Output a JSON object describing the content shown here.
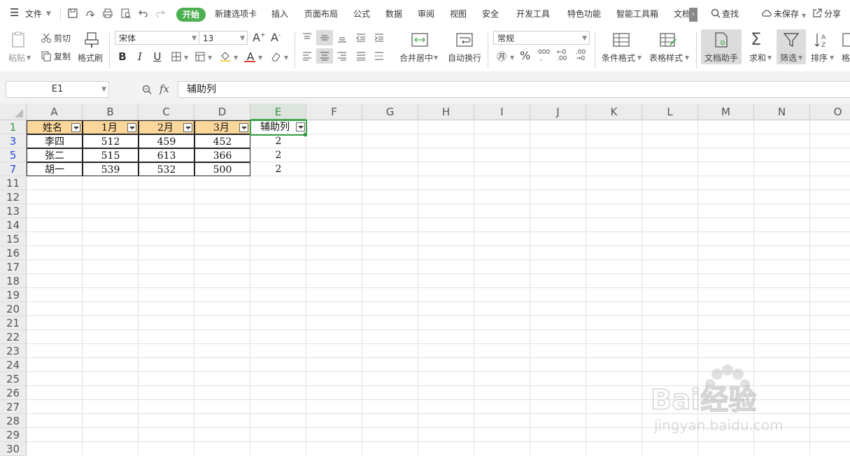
{
  "menu": {
    "file": "文件",
    "tabs": [
      "开始",
      "新建选项卡",
      "插入",
      "页面布局",
      "公式",
      "数据",
      "审阅",
      "视图",
      "安全",
      "开发工具",
      "特色功能",
      "智能工具箱",
      "文档"
    ],
    "search": "查找",
    "unsaved": "未保存",
    "share": "分享"
  },
  "ribbon": {
    "paste": "粘贴",
    "cut": "剪切",
    "copy": "复制",
    "format_painter": "格式刷",
    "font_name": "宋体",
    "font_size": "13",
    "merge_center": "合并居中",
    "wrap_text": "自动换行",
    "number_format": "常规",
    "conditional_format": "条件格式",
    "table_style": "表格样式",
    "doc_assistant": "文档助手",
    "sum": "求和",
    "filter": "筛选",
    "sort": "排序",
    "format_cut": "格"
  },
  "formula_bar": {
    "cell_ref": "E1",
    "fx": "fx",
    "content": "辅助列"
  },
  "grid": {
    "columns": [
      "A",
      "B",
      "C",
      "D",
      "E",
      "F",
      "G",
      "H",
      "I",
      "J",
      "K",
      "L",
      "M",
      "N",
      "O"
    ],
    "rows": [
      "1",
      "3",
      "5",
      "7",
      "11",
      "12",
      "13",
      "14",
      "15",
      "16",
      "17",
      "18",
      "19",
      "20",
      "21",
      "22",
      "23",
      "24",
      "25",
      "26",
      "27",
      "28",
      "29",
      "30"
    ],
    "header": [
      "姓名",
      "1月",
      "2月",
      "3月",
      "辅助列"
    ],
    "data": [
      [
        "李四",
        "512",
        "459",
        "452",
        "2"
      ],
      [
        "张二",
        "515",
        "613",
        "366",
        "2"
      ],
      [
        "胡一",
        "539",
        "532",
        "500",
        "2"
      ]
    ]
  },
  "watermark": {
    "text": "Bai经验",
    "sub": "jingyan.baidu.com"
  },
  "colors": {
    "accent": "#4caf50",
    "header_fill": "#fbd79b",
    "filtered_row": "#2b4bd6"
  }
}
